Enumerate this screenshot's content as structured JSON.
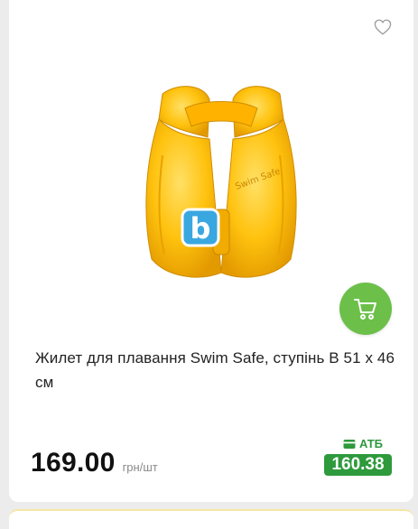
{
  "product": {
    "title": "Жилет для плавання Swim Safe, ступінь B 51 х 46 см",
    "image_label": "Swim Safe",
    "badge_letter": "b",
    "price": "169.00",
    "unit": "грн/шт",
    "card_price_label": "АТБ",
    "card_price": "160.38"
  },
  "icons": {
    "favorite": "heart-icon",
    "cart": "cart-icon",
    "card": "wallet-icon"
  },
  "colors": {
    "cart_button": "#6cc04a",
    "atb_green": "#2e9a3c",
    "vest_yellow": "#ffc20e"
  }
}
